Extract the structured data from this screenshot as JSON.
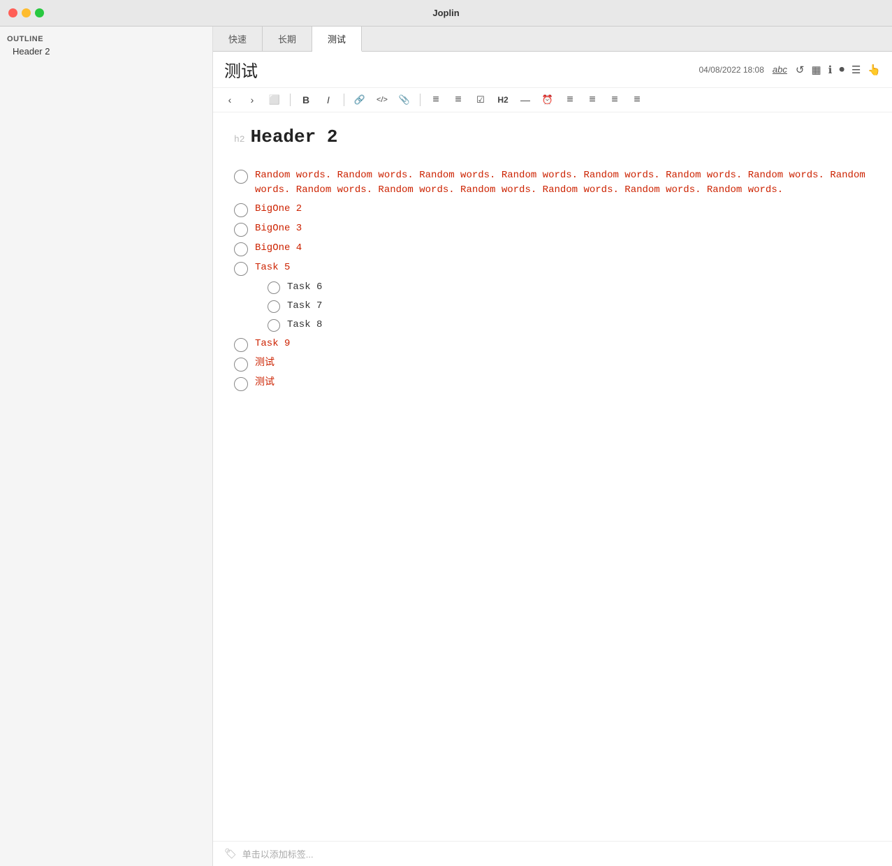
{
  "window": {
    "title": "Joplin"
  },
  "traffic_lights": {
    "red": "red",
    "yellow": "yellow",
    "green": "green"
  },
  "outline": {
    "label": "OUTLINE",
    "header2": "Header 2"
  },
  "tabs": [
    {
      "label": "快速",
      "active": false
    },
    {
      "label": "长期",
      "active": false
    },
    {
      "label": "测试",
      "active": true
    }
  ],
  "note": {
    "title": "测试",
    "datetime": "04/08/2022 18:08",
    "spell_check": "abc"
  },
  "toolbar": {
    "back": "‹",
    "forward": "›",
    "open": "⬜",
    "bold": "B",
    "italic": "I",
    "link": "🔗",
    "code": "</>",
    "attach": "📎",
    "bullet_list": "≡",
    "num_list": "≡",
    "check_list": "☑",
    "h2": "H2",
    "hr": "—",
    "clock": "⏰",
    "align_left": "≡",
    "align_center": "≡",
    "align_right": "≡",
    "more": "≡"
  },
  "content": {
    "h2_label": "h2",
    "h2_text": "Header 2",
    "random_text": "Random words. Random words. Random words. Random words. Random words. Random words. Random words. Random words. Random words. Random words. Random words. Random words. Random words. Random words.",
    "tasks": [
      {
        "label": "BigOne 2",
        "indented": false,
        "color": "red"
      },
      {
        "label": "BigOne 3",
        "indented": false,
        "color": "red"
      },
      {
        "label": "BigOne 4",
        "indented": false,
        "color": "red"
      },
      {
        "label": "Task 5",
        "indented": false,
        "color": "red"
      },
      {
        "label": "Task 6",
        "indented": true,
        "color": "black"
      },
      {
        "label": "Task 7",
        "indented": true,
        "color": "black"
      },
      {
        "label": "Task 8",
        "indented": true,
        "color": "black"
      },
      {
        "label": "Task 9",
        "indented": false,
        "color": "red"
      },
      {
        "label": "测试",
        "indented": false,
        "color": "red"
      },
      {
        "label": "测试",
        "indented": false,
        "color": "red"
      }
    ]
  },
  "tag_bar": {
    "placeholder": "单击以添加标签..."
  }
}
